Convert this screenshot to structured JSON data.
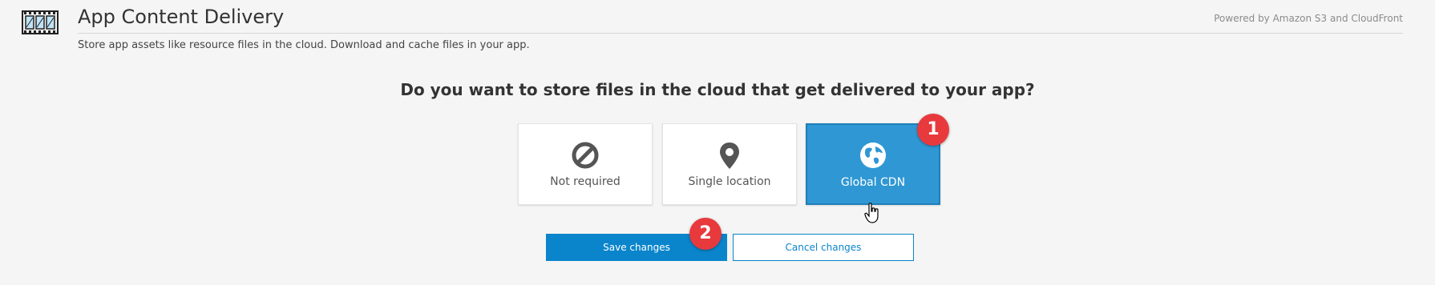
{
  "header": {
    "title": "App Content Delivery",
    "subtitle": "Store app assets like resource files in the cloud. Download and cache files in your app.",
    "powered_by": "Powered by Amazon S3 and CloudFront"
  },
  "question": "Do you want to store files in the cloud that get delivered to your app?",
  "options": [
    {
      "label": "Not required",
      "icon": "no-entry-icon",
      "selected": false
    },
    {
      "label": "Single location",
      "icon": "map-pin-icon",
      "selected": false
    },
    {
      "label": "Global CDN",
      "icon": "globe-icon",
      "selected": true
    }
  ],
  "annotations": [
    "1",
    "2"
  ],
  "buttons": {
    "save_label": "Save changes",
    "cancel_label": "Cancel changes"
  },
  "colors": {
    "accent": "#0a85cc",
    "selected_bg": "#2f98d4",
    "badge": "#e8393d"
  }
}
